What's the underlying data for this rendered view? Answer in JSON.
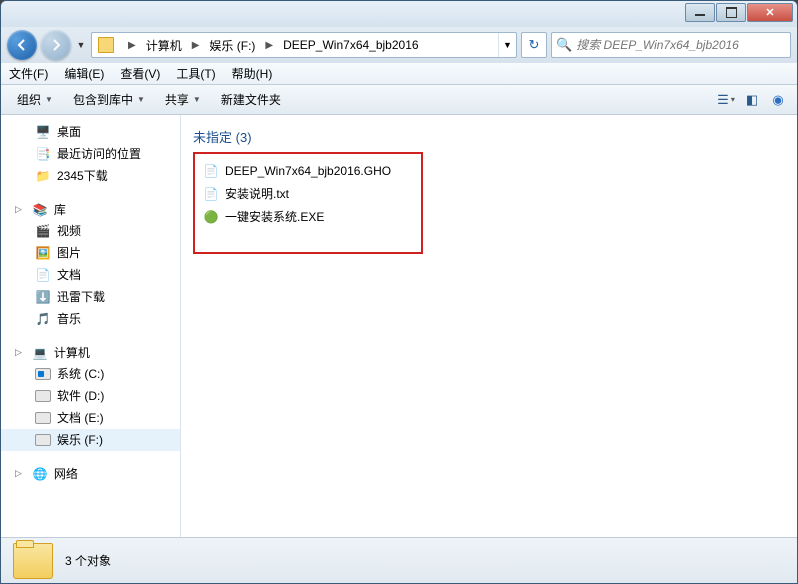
{
  "titlebar": {},
  "nav": {
    "breadcrumbs": [
      "计算机",
      "娱乐 (F:)",
      "DEEP_Win7x64_bjb2016"
    ]
  },
  "search": {
    "placeholder": "搜索 DEEP_Win7x64_bjb2016"
  },
  "menubar": {
    "file": "文件(F)",
    "edit": "编辑(E)",
    "view": "查看(V)",
    "tools": "工具(T)",
    "help": "帮助(H)"
  },
  "toolbar": {
    "organize": "组织",
    "include": "包含到库中",
    "share": "共享",
    "newfolder": "新建文件夹"
  },
  "sidebar": {
    "fav": {
      "desktop": "桌面",
      "recent": "最近访问的位置",
      "dl": "2345下载"
    },
    "lib": {
      "header": "库",
      "video": "视频",
      "pic": "图片",
      "doc": "文档",
      "xunlei": "迅雷下载",
      "music": "音乐"
    },
    "computer": {
      "header": "计算机",
      "c": "系统 (C:)",
      "d": "软件 (D:)",
      "e": "文档 (E:)",
      "f": "娱乐 (F:)"
    },
    "network": {
      "header": "网络"
    }
  },
  "content": {
    "section": {
      "label": "未指定",
      "count": "(3)"
    },
    "files": [
      {
        "name": "DEEP_Win7x64_bjb2016.GHO",
        "type": "file"
      },
      {
        "name": "安装说明.txt",
        "type": "txt"
      },
      {
        "name": "一键安装系统.EXE",
        "type": "exe"
      }
    ]
  },
  "status": {
    "count": "3 个对象"
  }
}
